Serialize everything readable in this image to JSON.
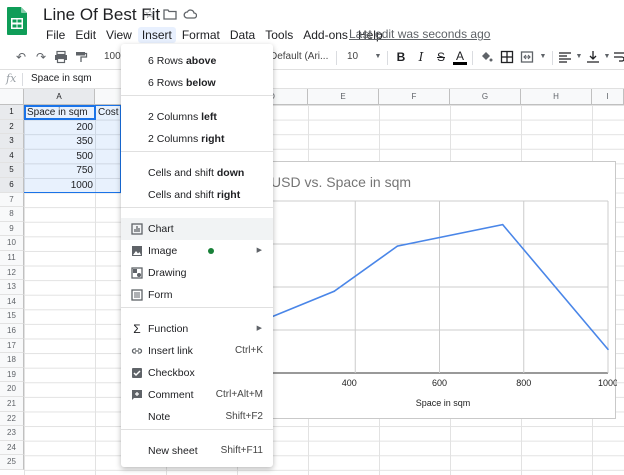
{
  "header": {
    "doc_title": "Line Of Best Fit",
    "last_edit": "Last edit was seconds ago",
    "menus": [
      "File",
      "Edit",
      "View",
      "Insert",
      "Format",
      "Data",
      "Tools",
      "Add-ons",
      "Help"
    ],
    "active_menu": "Insert"
  },
  "toolbar": {
    "zoom": "100",
    "font": "Default (Ari...",
    "font_size": "10"
  },
  "formula_bar": {
    "fx": "fx",
    "content": "Space in sqm"
  },
  "grid": {
    "columns": [
      "A",
      "B",
      "C",
      "D",
      "E",
      "F",
      "G",
      "H",
      "I"
    ],
    "rows": [
      "1",
      "2",
      "3",
      "4",
      "5",
      "6",
      "7",
      "8",
      "9",
      "10",
      "11",
      "12",
      "13",
      "14",
      "15",
      "16",
      "17",
      "18",
      "19",
      "20",
      "21",
      "22",
      "23",
      "24",
      "25"
    ],
    "header_a": "Space in sqm",
    "header_b": "Cost i",
    "values_a": [
      "200",
      "350",
      "500",
      "750",
      "1000"
    ]
  },
  "insert_menu": {
    "items": [
      {
        "pre": "6 Rows ",
        "bold": "above",
        "shortcut": ""
      },
      {
        "pre": "6 Rows ",
        "bold": "below",
        "shortcut": ""
      },
      {
        "pre": "2 Columns ",
        "bold": "left",
        "shortcut": ""
      },
      {
        "pre": "2 Columns ",
        "bold": "right",
        "shortcut": ""
      },
      {
        "pre": "Cells and shift ",
        "bold": "down",
        "shortcut": ""
      },
      {
        "pre": "Cells and shift ",
        "bold": "right",
        "shortcut": ""
      },
      {
        "pre": "Chart",
        "bold": "",
        "shortcut": "",
        "icon": "chart-icon"
      },
      {
        "pre": "Image",
        "bold": "",
        "shortcut": "",
        "icon": "image-icon"
      },
      {
        "pre": "Drawing",
        "bold": "",
        "shortcut": "",
        "icon": "drawing-icon"
      },
      {
        "pre": "Form",
        "bold": "",
        "shortcut": "",
        "icon": "form-icon"
      },
      {
        "pre": "Function",
        "bold": "",
        "shortcut": "",
        "icon": "sigma-icon"
      },
      {
        "pre": "Insert link",
        "bold": "",
        "shortcut": "Ctrl+K",
        "icon": "link-icon"
      },
      {
        "pre": "Checkbox",
        "bold": "",
        "shortcut": "",
        "icon": "checkbox-icon"
      },
      {
        "pre": "Comment",
        "bold": "",
        "shortcut": "Ctrl+Alt+M",
        "icon": "comment-icon"
      },
      {
        "pre": "Note",
        "bold": "",
        "shortcut": "Shift+F2"
      },
      {
        "pre": "New sheet",
        "bold": "",
        "shortcut": "Shift+F11"
      }
    ]
  },
  "chart_data": {
    "type": "line",
    "title": "USD vs. Space in sqm",
    "xlabel": "Space in sqm",
    "x_ticks": [
      "400",
      "600",
      "800",
      "1000"
    ],
    "x": [
      200,
      350,
      500,
      750,
      1000
    ],
    "y": [
      26,
      38,
      59,
      69,
      11
    ],
    "xlim": [
      200,
      1000
    ],
    "ylim": [
      0,
      80
    ],
    "series_color": "#4a86e8",
    "grid": true
  },
  "colors": {
    "accent": "#1a73e8",
    "sheets_green": "#0f9d58",
    "image_dot": "#188038"
  }
}
